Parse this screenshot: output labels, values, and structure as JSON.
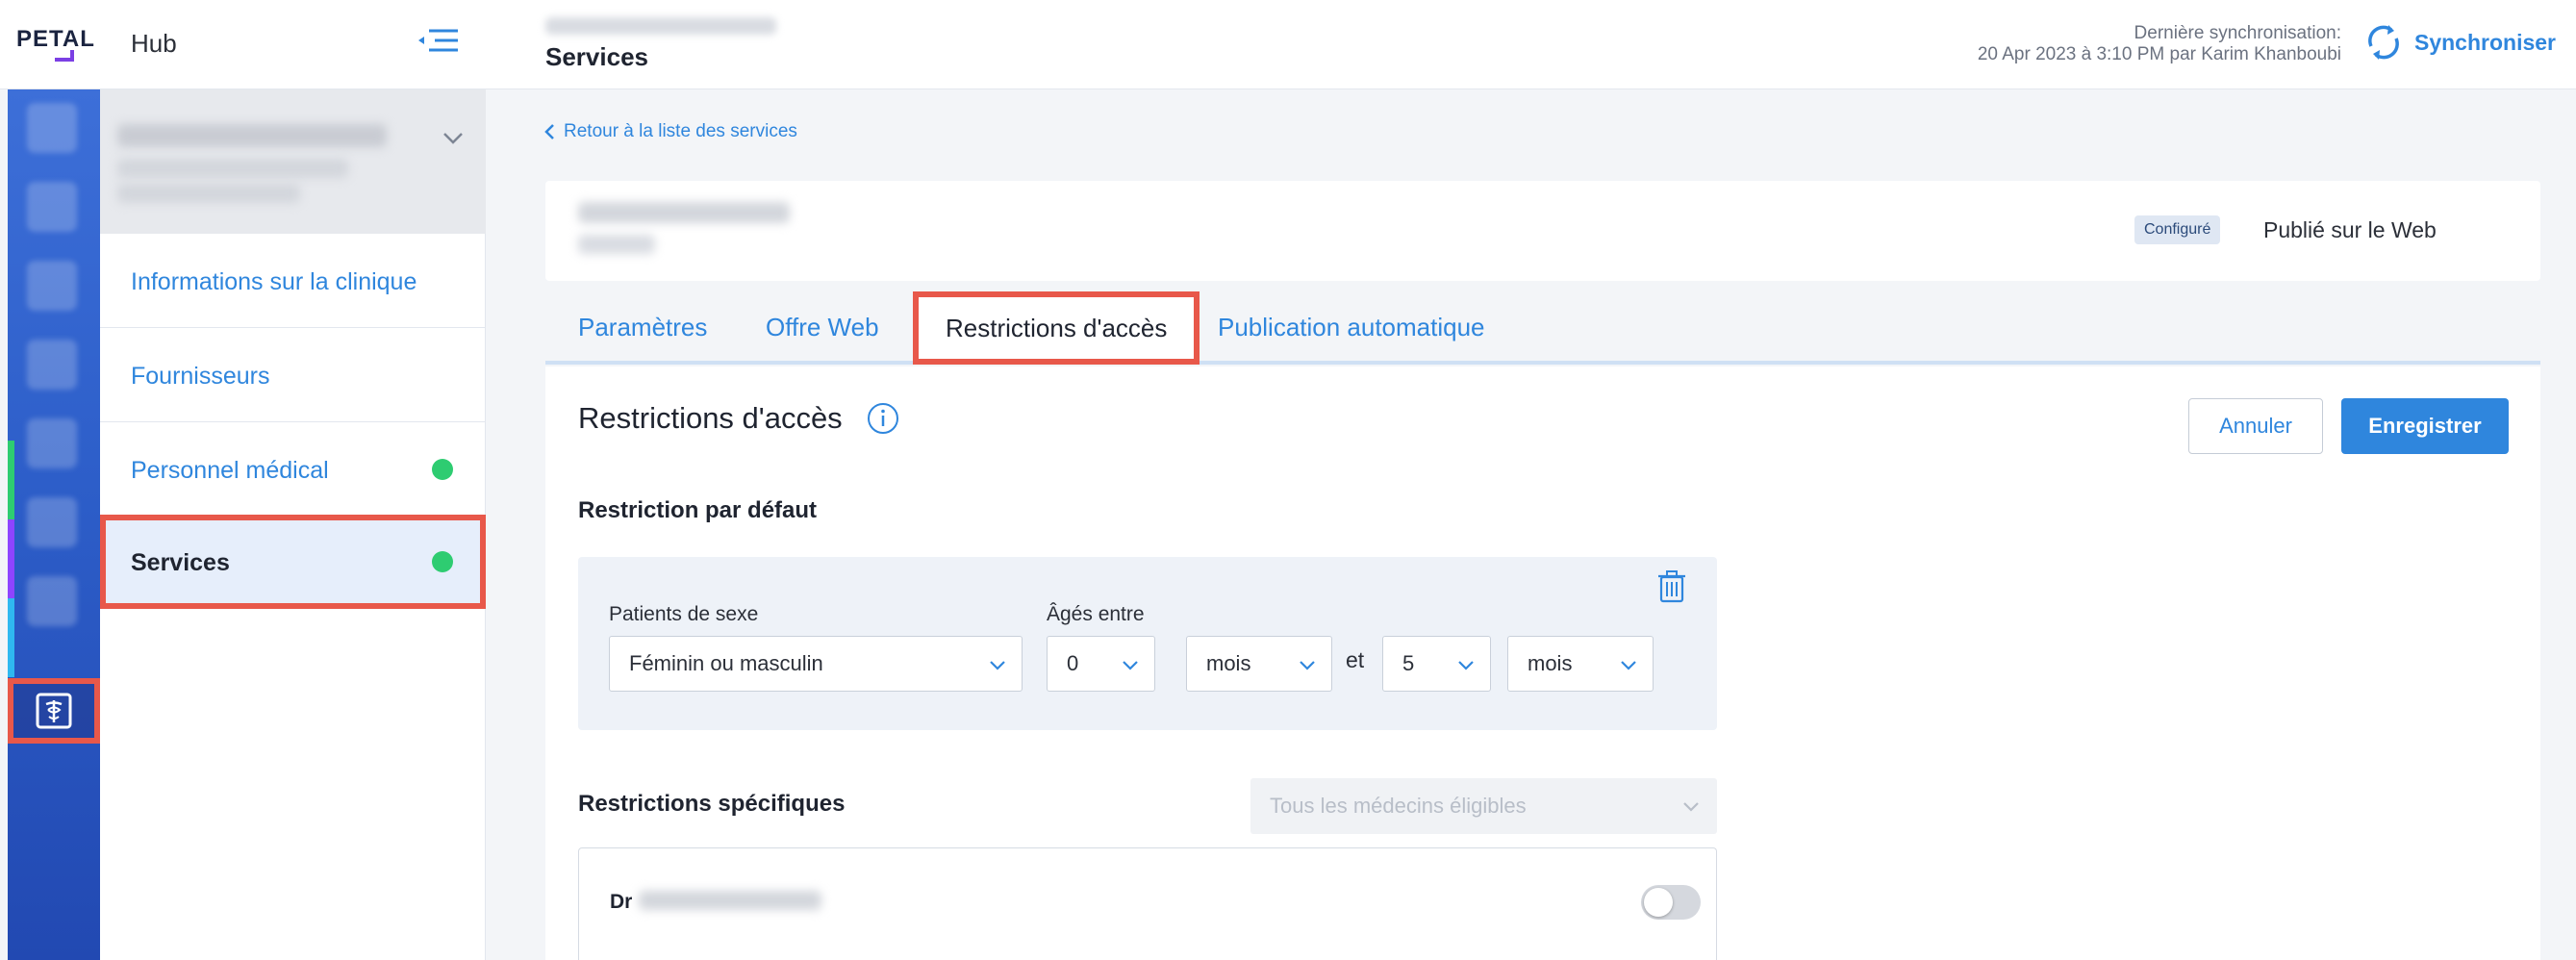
{
  "header": {
    "logo_text": "PETAL",
    "hub_title": "Hub",
    "page_title": "Services",
    "sync_label_line1": "Dernière synchronisation:",
    "sync_label_line2": "20 Apr 2023 à 3:10 PM par Karim Khanboubi",
    "sync_button": "Synchroniser"
  },
  "sidebar": {
    "items": [
      {
        "label": "Informations sur la clinique",
        "status": null
      },
      {
        "label": "Fournisseurs",
        "status": null
      },
      {
        "label": "Personnel médical",
        "status": "green"
      },
      {
        "label": "Services",
        "status": "green",
        "active": true
      }
    ]
  },
  "main": {
    "back_link": "Retour à la liste des services",
    "status_badge": "Configuré",
    "published_label": "Publié sur le Web",
    "tabs": [
      {
        "label": "Paramètres"
      },
      {
        "label": "Offre Web"
      },
      {
        "label": "Restrictions d'accès",
        "active": true
      },
      {
        "label": "Publication automatique"
      }
    ],
    "panel_title": "Restrictions d'accès",
    "cancel_button": "Annuler",
    "save_button": "Enregistrer",
    "default_restriction": {
      "title": "Restriction par défaut",
      "sex_label": "Patients de sexe",
      "sex_value": "Féminin ou masculin",
      "age_label": "Âgés entre",
      "age_min": "0",
      "age_min_unit": "mois",
      "and_label": "et",
      "age_max": "5",
      "age_max_unit": "mois"
    },
    "specific_restrictions": {
      "title": "Restrictions spécifiques",
      "doctors_placeholder": "Tous les médecins éligibles",
      "doctor_prefix": "Dr"
    }
  },
  "colors": {
    "accent": "#2f86dd",
    "highlight": "#e8584a",
    "status_green": "#2ecc71"
  }
}
